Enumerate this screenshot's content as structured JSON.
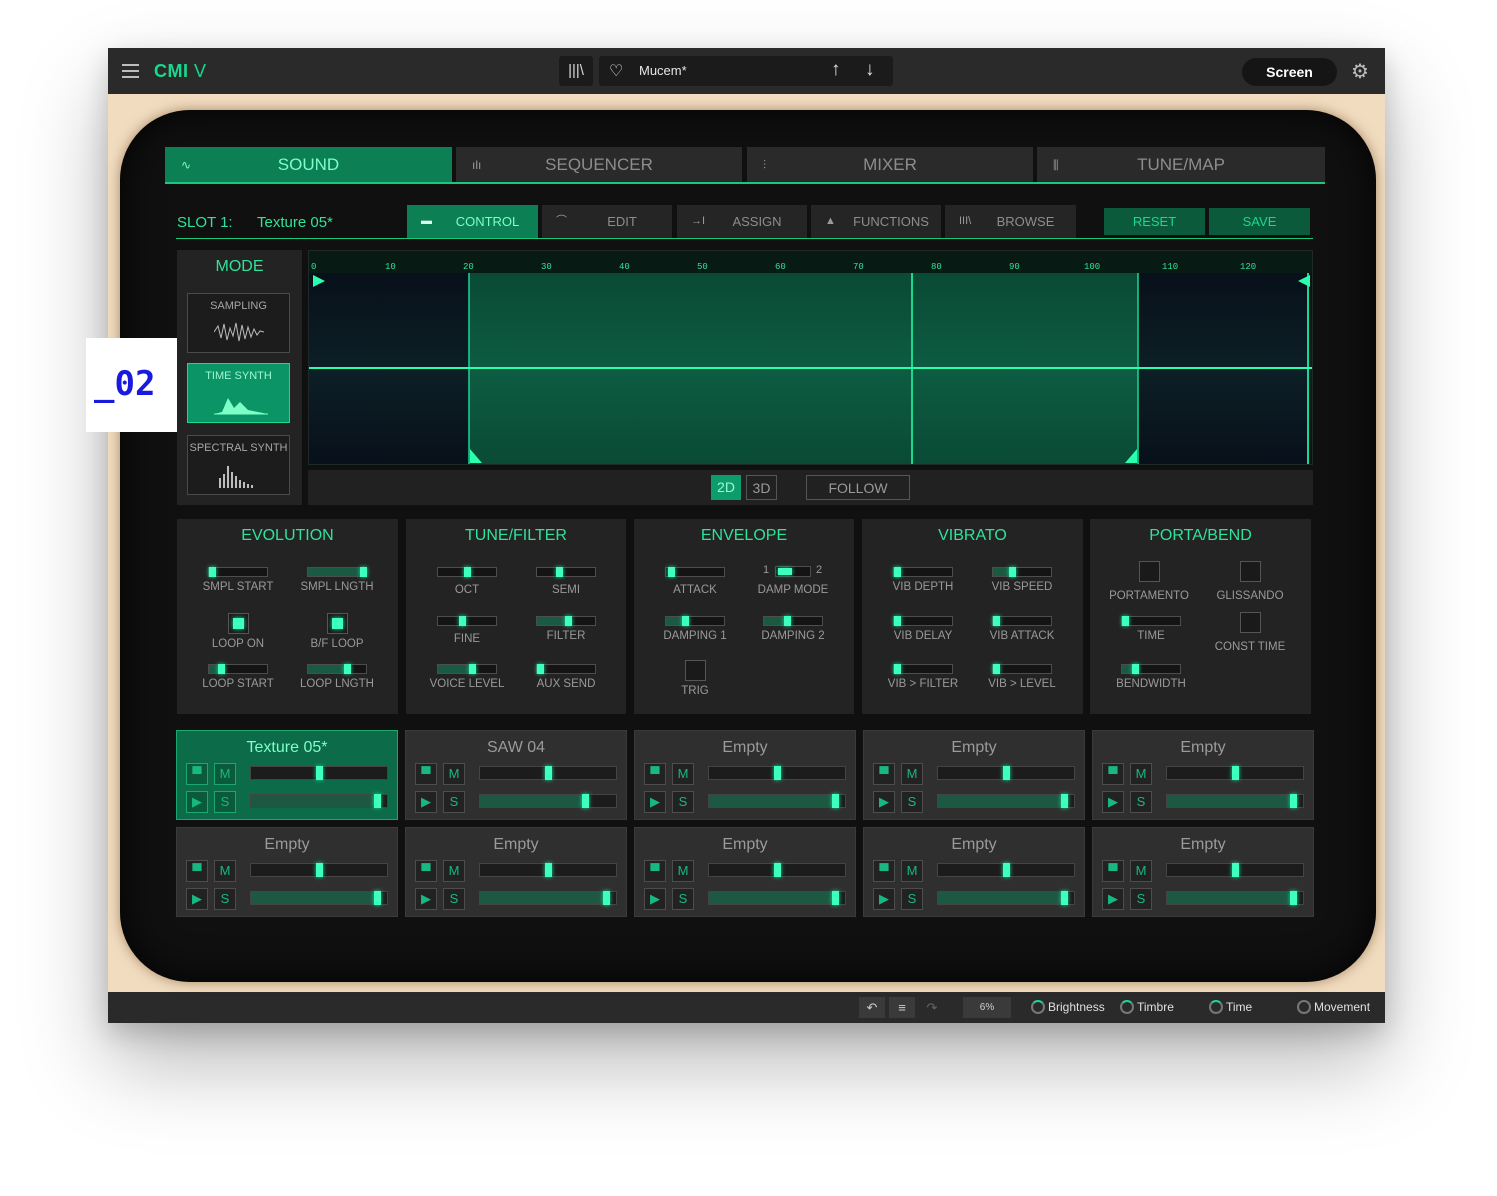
{
  "app": {
    "logo_main": "CMI",
    "logo_suffix": "V"
  },
  "header": {
    "library_icon": "library-icon",
    "preset_name": "Mucem*",
    "screen_button": "Screen"
  },
  "main_tabs": [
    {
      "label": "SOUND",
      "icon": "∿"
    },
    {
      "label": "SEQUENCER",
      "icon": "ılı"
    },
    {
      "label": "MIXER",
      "icon": "⫶"
    },
    {
      "label": "TUNE/MAP",
      "icon": "⫼"
    }
  ],
  "slot_header": {
    "label": "SLOT 1:",
    "name": "Texture 05*"
  },
  "sub_tabs": [
    {
      "label": "CONTROL",
      "icon": "▬"
    },
    {
      "label": "EDIT",
      "icon": "⌒"
    },
    {
      "label": "ASSIGN",
      "icon": "→I"
    },
    {
      "label": "FUNCTIONS",
      "icon": "▲"
    },
    {
      "label": "BROWSE",
      "icon": "III\\"
    }
  ],
  "actions": {
    "reset": "RESET",
    "save": "SAVE"
  },
  "mode": {
    "title": "MODE",
    "options": [
      {
        "label": "SAMPLING"
      },
      {
        "label": "TIME SYNTH"
      },
      {
        "label": "SPECTRAL SYNTH"
      }
    ]
  },
  "waveform": {
    "ruler": [
      "0",
      "10",
      "20",
      "30",
      "40",
      "50",
      "60",
      "70",
      "80",
      "90",
      "100",
      "110",
      "120"
    ]
  },
  "view": {
    "btn_2d": "2D",
    "btn_3d": "3D",
    "follow": "FOLLOW"
  },
  "panels": {
    "evolution": {
      "title": "EVOLUTION",
      "smpl_start": "SMPL START",
      "smpl_lngth": "SMPL LNGTH",
      "loop_on": "LOOP ON",
      "bf_loop": "B/F LOOP",
      "loop_start": "LOOP START",
      "loop_lngth": "LOOP LNGTH"
    },
    "tune_filter": {
      "title": "TUNE/FILTER",
      "oct": "OCT",
      "semi": "SEMI",
      "fine": "FINE",
      "filter": "FILTER",
      "voice_level": "VOICE LEVEL",
      "aux_send": "AUX SEND"
    },
    "envelope": {
      "title": "ENVELOPE",
      "attack": "ATTACK",
      "damp_mode": "DAMP MODE",
      "damp_mode_1": "1",
      "damp_mode_2": "2",
      "damping_1": "DAMPING 1",
      "damping_2": "DAMPING 2",
      "trig": "TRIG"
    },
    "vibrato": {
      "title": "VIBRATO",
      "vib_depth": "VIB DEPTH",
      "vib_speed": "VIB SPEED",
      "vib_delay": "VIB DELAY",
      "vib_attack": "VIB ATTACK",
      "vib_filter": "VIB > FILTER",
      "vib_level": "VIB > LEVEL"
    },
    "porta_bend": {
      "title": "PORTA/BEND",
      "portamento": "PORTAMENTO",
      "glissando": "GLISSANDO",
      "time": "TIME",
      "const_time": "CONST TIME",
      "bendwidth": "BENDWIDTH"
    }
  },
  "slots": [
    {
      "name": "Texture 05*",
      "volume": 0.5,
      "pan": 0.92
    },
    {
      "name": "SAW 04",
      "volume": 0.5,
      "pan": 0.77
    },
    {
      "name": "Empty",
      "volume": 0.5,
      "pan": 0.92
    },
    {
      "name": "Empty",
      "volume": 0.5,
      "pan": 0.92
    },
    {
      "name": "Empty",
      "volume": 0.5,
      "pan": 0.92
    },
    {
      "name": "Empty",
      "volume": 0.5,
      "pan": 0.92
    },
    {
      "name": "Empty",
      "volume": 0.5,
      "pan": 0.92
    },
    {
      "name": "Empty",
      "volume": 0.5,
      "pan": 0.92
    },
    {
      "name": "Empty",
      "volume": 0.5,
      "pan": 0.92
    },
    {
      "name": "Empty",
      "volume": 0.5,
      "pan": 0.92
    }
  ],
  "slot_buttons": {
    "mute": "M",
    "solo": "S"
  },
  "bottom_bar": {
    "cpu": "6%",
    "macros": [
      "Brightness",
      "Timbre",
      "Time",
      "Movement"
    ]
  },
  "badge": "_02",
  "colors": {
    "accent": "#19d88f",
    "active_tab": "#0d7f55",
    "panel": "#232323",
    "badge_text": "#1a1adf"
  }
}
